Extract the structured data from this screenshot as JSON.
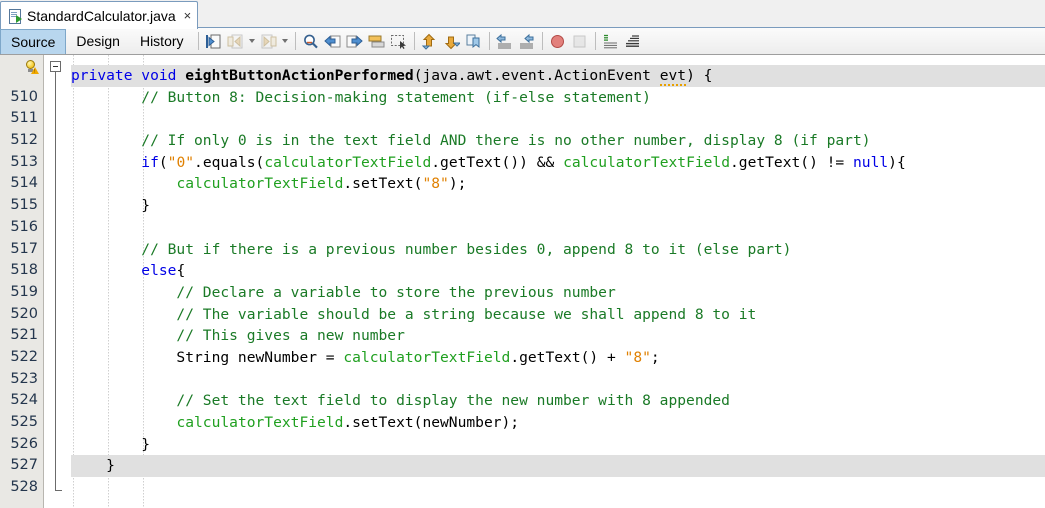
{
  "window": {
    "tab": {
      "title": "StandardCalculator.java",
      "close": "×",
      "icon": "java-file-icon"
    }
  },
  "toolbar": {
    "views": [
      {
        "label": "Source",
        "active": true
      },
      {
        "label": "Design",
        "active": false
      },
      {
        "label": "History",
        "active": false
      }
    ],
    "buttons": [
      {
        "name": "last-edit-icon",
        "glyph": "↦"
      },
      {
        "name": "back-icon",
        "glyph": "⇐"
      },
      {
        "name": "back-dropdown-icon",
        "glyph": "▾"
      },
      {
        "name": "forward-icon",
        "glyph": "⇒"
      },
      {
        "name": "forward-dropdown-icon",
        "glyph": "▾"
      },
      {
        "name": "find-selection-icon",
        "glyph": "⌕"
      },
      {
        "name": "find-previous-icon",
        "glyph": "⇐"
      },
      {
        "name": "find-next-icon",
        "glyph": "⇒"
      },
      {
        "name": "toggle-highlight-icon",
        "glyph": "▭"
      },
      {
        "name": "toggle-rectangular-selection-icon",
        "glyph": "⬚"
      },
      {
        "name": "previous-bookmark-icon",
        "glyph": "⬆"
      },
      {
        "name": "next-bookmark-icon",
        "glyph": "⬇"
      },
      {
        "name": "toggle-bookmark-icon",
        "glyph": "⚑"
      },
      {
        "name": "shift-left-icon",
        "glyph": "⇦"
      },
      {
        "name": "shift-right-icon",
        "glyph": "⇨"
      },
      {
        "name": "start-macro-recording-icon",
        "glyph": "●"
      },
      {
        "name": "stop-macro-recording-icon",
        "glyph": "■"
      },
      {
        "name": "comment-icon",
        "glyph": "≡"
      },
      {
        "name": "uncomment-icon",
        "glyph": "≡"
      }
    ]
  },
  "editor": {
    "top_partial_line": "509",
    "first_line_number": 510,
    "warning_bulb_line": 509,
    "current_line_highlight_rows": [
      0,
      18
    ],
    "lines": [
      {
        "num": "",
        "indent": 0,
        "tokens": [
          {
            "t": "private ",
            "c": "kw"
          },
          {
            "t": "void ",
            "c": "kw"
          },
          {
            "t": "eightButtonActionPerformed",
            "c": "bold"
          },
          {
            "t": "(java.awt.event.ActionEvent ",
            "c": ""
          },
          {
            "t": "evt",
            "c": "sq"
          },
          {
            "t": ") {",
            "c": ""
          }
        ]
      },
      {
        "num": "510",
        "indent": 0,
        "tokens": [
          {
            "t": "        // Button 8: Decision-making statement (if-else statement)",
            "c": "cmt"
          }
        ]
      },
      {
        "num": "511",
        "indent": 0,
        "tokens": [
          {
            "t": "",
            "c": ""
          }
        ]
      },
      {
        "num": "512",
        "indent": 0,
        "tokens": [
          {
            "t": "        // If only 0 is in the text field AND there is no other number, display 8 (if part)",
            "c": "cmt"
          }
        ]
      },
      {
        "num": "513",
        "indent": 0,
        "tokens": [
          {
            "t": "        ",
            "c": ""
          },
          {
            "t": "if",
            "c": "kw"
          },
          {
            "t": "(",
            "c": ""
          },
          {
            "t": "\"0\"",
            "c": "str"
          },
          {
            "t": ".equals(",
            "c": ""
          },
          {
            "t": "calculatorTextField",
            "c": "fld"
          },
          {
            "t": ".getText()) && ",
            "c": ""
          },
          {
            "t": "calculatorTextField",
            "c": "fld"
          },
          {
            "t": ".getText() != ",
            "c": ""
          },
          {
            "t": "null",
            "c": "kw"
          },
          {
            "t": "){",
            "c": ""
          }
        ]
      },
      {
        "num": "514",
        "indent": 0,
        "tokens": [
          {
            "t": "            ",
            "c": ""
          },
          {
            "t": "calculatorTextField",
            "c": "fld"
          },
          {
            "t": ".setText(",
            "c": ""
          },
          {
            "t": "\"8\"",
            "c": "str"
          },
          {
            "t": ");",
            "c": ""
          }
        ]
      },
      {
        "num": "515",
        "indent": 0,
        "tokens": [
          {
            "t": "        }",
            "c": ""
          }
        ]
      },
      {
        "num": "516",
        "indent": 0,
        "tokens": [
          {
            "t": "",
            "c": ""
          }
        ]
      },
      {
        "num": "517",
        "indent": 0,
        "tokens": [
          {
            "t": "        // But if there is a previous number besides 0, append 8 to it (else part)",
            "c": "cmt"
          }
        ]
      },
      {
        "num": "518",
        "indent": 0,
        "tokens": [
          {
            "t": "        ",
            "c": ""
          },
          {
            "t": "else",
            "c": "kw"
          },
          {
            "t": "{",
            "c": ""
          }
        ]
      },
      {
        "num": "519",
        "indent": 0,
        "tokens": [
          {
            "t": "            // Declare a variable to store the previous number",
            "c": "cmt"
          }
        ]
      },
      {
        "num": "520",
        "indent": 0,
        "tokens": [
          {
            "t": "            // The variable should be a string because we shall append 8 to it",
            "c": "cmt"
          }
        ]
      },
      {
        "num": "521",
        "indent": 0,
        "tokens": [
          {
            "t": "            // This gives a new number",
            "c": "cmt"
          }
        ]
      },
      {
        "num": "522",
        "indent": 0,
        "tokens": [
          {
            "t": "            String newNumber = ",
            "c": ""
          },
          {
            "t": "calculatorTextField",
            "c": "fld"
          },
          {
            "t": ".getText() + ",
            "c": ""
          },
          {
            "t": "\"8\"",
            "c": "str"
          },
          {
            "t": ";",
            "c": ""
          }
        ]
      },
      {
        "num": "523",
        "indent": 0,
        "tokens": [
          {
            "t": "",
            "c": ""
          }
        ]
      },
      {
        "num": "524",
        "indent": 0,
        "tokens": [
          {
            "t": "            // Set the text field to display the new number with 8 appended",
            "c": "cmt"
          }
        ]
      },
      {
        "num": "525",
        "indent": 0,
        "tokens": [
          {
            "t": "            ",
            "c": ""
          },
          {
            "t": "calculatorTextField",
            "c": "fld"
          },
          {
            "t": ".setText(newNumber);",
            "c": ""
          }
        ]
      },
      {
        "num": "526",
        "indent": 0,
        "tokens": [
          {
            "t": "        }",
            "c": ""
          }
        ]
      },
      {
        "num": "527",
        "indent": 0,
        "tokens": [
          {
            "t": "    }",
            "c": ""
          }
        ]
      },
      {
        "num": "528",
        "indent": 0,
        "tokens": [
          {
            "t": "",
            "c": ""
          }
        ]
      }
    ]
  },
  "colors": {
    "keyword": "#0000e6",
    "comment": "#1a7a26",
    "string": "#e08000",
    "field": "#20a020",
    "current_line": "#e0e0e0",
    "gutter_bg": "#e9e8e4",
    "tab_border": "#7a9bbd",
    "active_view_tab": "#b8d6ee"
  }
}
